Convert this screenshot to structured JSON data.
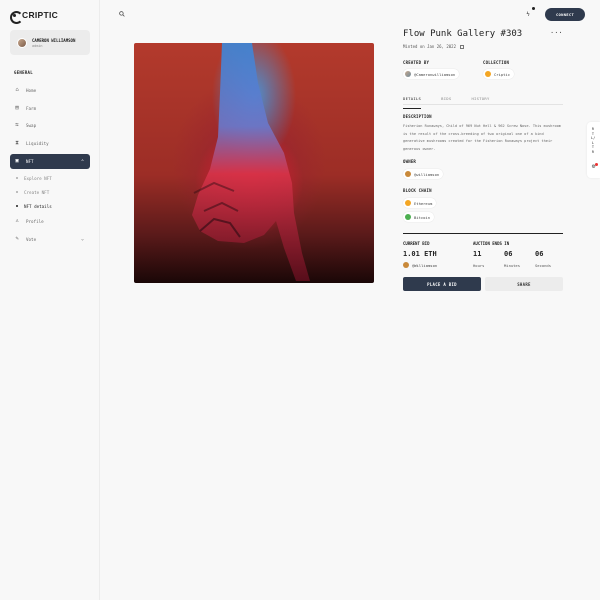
{
  "app": {
    "name": "CRIPTIC"
  },
  "profile": {
    "name": "CAMERON WILLIAMSON",
    "role": "admin"
  },
  "sidebar": {
    "section_label": "GENERAL",
    "items": [
      {
        "label": "Home",
        "icon": "home-icon"
      },
      {
        "label": "Farm",
        "icon": "farm-icon"
      },
      {
        "label": "Swap",
        "icon": "swap-icon"
      },
      {
        "label": "Liquidity",
        "icon": "liquidity-icon"
      },
      {
        "label": "NFT",
        "icon": "nft-icon",
        "active": true
      },
      {
        "label": "Profile",
        "icon": "profile-icon"
      },
      {
        "label": "Vote",
        "icon": "vote-icon"
      }
    ],
    "nft_sub": [
      {
        "label": "Explore NFT"
      },
      {
        "label": "Create NFT"
      },
      {
        "label": "NFT details",
        "current": true
      }
    ]
  },
  "topbar": {
    "connect_label": "CONNECT"
  },
  "nft": {
    "title": "Flow Punk Gallery #303",
    "minted": "Minted on Jan 26, 2022",
    "created_by_label": "CREATED BY",
    "creator": "@Cameronwilliamson",
    "collection_label": "COLLECTION",
    "collection": "Criptic",
    "tabs": [
      "DETAILS",
      "BIDS",
      "HISTORY"
    ],
    "description_label": "DESCRIPTION",
    "description": "Fisherion Runaways, Child of 969 Nut Hell & 962 Screw Nose. This mushroom is the result of the cross-breeding of two original one of a kind generative mushrooms created for the Fisherion Runaways project their generous owner.",
    "owner_label": "OWNER",
    "owner": "@williamson",
    "block_chain_label": "BLOCK CHAIN",
    "chains": [
      "Ethereum",
      "Bitcoin"
    ],
    "current_bid_label": "CURRENT BID",
    "current_bid": "1.01 ETH",
    "bidder": "@Williamson",
    "auction_label": "AUCTION ENDS IN",
    "countdown": [
      {
        "value": "11",
        "unit": "Hours"
      },
      {
        "value": "06",
        "unit": "Minutes"
      },
      {
        "value": "06",
        "unit": "Seconds"
      }
    ],
    "place_bid_label": "PLACE A BID",
    "share_label": "SHARE"
  },
  "float_panel": {
    "text": "RTL/LTR"
  },
  "colors": {
    "primary": "#2f3a4d",
    "background": "#f8f8f8",
    "accent_eth": "#f4a623",
    "accent_btc": "#4caf50"
  }
}
